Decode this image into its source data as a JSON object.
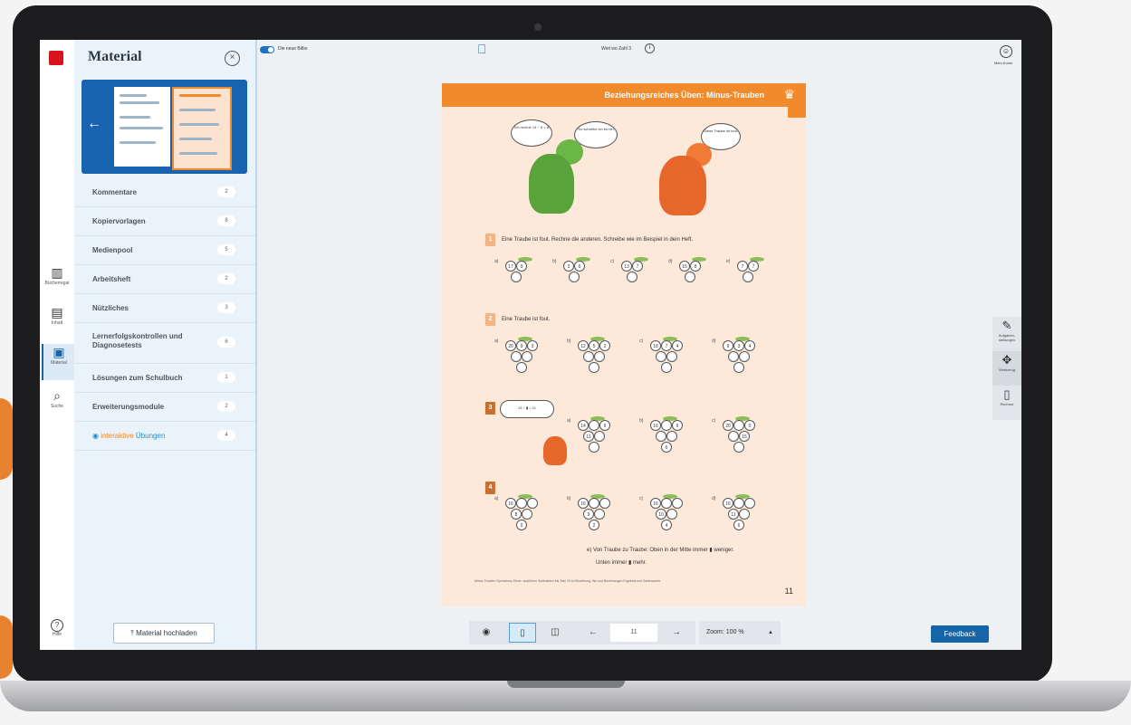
{
  "sidebar_rail": {
    "items": [
      {
        "label": "Bücherregal",
        "icon": "bookshelf-icon"
      },
      {
        "label": "Inhalt",
        "icon": "book-icon"
      },
      {
        "label": "Material",
        "icon": "material-icon"
      },
      {
        "label": "Suche",
        "icon": "search-icon"
      }
    ],
    "help_label": "Hilfe"
  },
  "panel": {
    "title": "Material",
    "items": [
      {
        "label": "Kommentare",
        "count": "2"
      },
      {
        "label": "Kopiervorlagen",
        "count": "8"
      },
      {
        "label": "Medienpool",
        "count": "5"
      },
      {
        "label": "Arbeitsheft",
        "count": "2"
      },
      {
        "label": "Nützliches",
        "count": "3"
      },
      {
        "label": "Lernerfolgskontrollen und Diagnosetests",
        "count": "6"
      },
      {
        "label": "Lösungen zum Schulbuch",
        "count": "1"
      },
      {
        "label": "Erweiterungsmodule",
        "count": "2"
      },
      {
        "label_a": "interaktive",
        "label_b": "Übungen",
        "count": "4"
      }
    ],
    "upload_label": "Material hochladen"
  },
  "header": {
    "toggle_label": "Die neue Bilbo",
    "breadcrumb": "Weit wo Zahl 3",
    "account_label": "Mein Konto"
  },
  "right_tools": [
    {
      "label": "Aufgaben-stellungen",
      "icon": "edit-icon"
    },
    {
      "label": "Werkzeug",
      "icon": "tools-icon"
    },
    {
      "label": "Rechner",
      "icon": "calculator-icon"
    }
  ],
  "page": {
    "title": "Beziehungsreiches Üben: Minus-Trauben",
    "task1": "Eine Traube ist fout. Rechne die anderen. Schreibe wie im Beispiel in dein Heft.",
    "task2": "Eine Traube ist fout.",
    "bottom_line": "e) Von Traube zu Traube: Oben in der Mitte immer ▮ weniger.",
    "bottom_line2": "Unten immer ▮ mehr.",
    "footnote": "Minus-Trauben Operations-Sinne: ausführen Subtraktion bis Zahl 20 im Beziehung. Wo und Beziehungen Ergebnis und Zahlenwerte.",
    "page_number": "11",
    "bubbles": [
      "Ich rechne 14 − 6 = 8",
      "So schreibe ich es hin",
      "Diese Traube ist fout."
    ],
    "hint_bubble": "13 − ▮ = 11",
    "grapes_row1": [
      {
        "label": "a)",
        "a": "17",
        "b": "9"
      },
      {
        "label": "b)",
        "a": "3",
        "b": "6"
      },
      {
        "label": "c)",
        "a": "13",
        "b": "7"
      },
      {
        "label": "d)",
        "a": "15",
        "b": "8"
      },
      {
        "label": "e)",
        "a": "7",
        "b": "7"
      }
    ],
    "grapes_row2": [
      {
        "label": "a)",
        "a": "20",
        "b": "9",
        "c": "3"
      },
      {
        "label": "b)",
        "a": "12",
        "b": "5",
        "c": "2"
      },
      {
        "label": "c)",
        "a": "18",
        "b": "7",
        "c": "4"
      },
      {
        "label": "d)",
        "a": "9",
        "b": "3",
        "c": "4"
      }
    ],
    "grapes_row3": [
      {
        "label": "a)",
        "a": "14",
        "b": "6",
        "c": "11"
      },
      {
        "label": "b)",
        "a": "16",
        "b": "6",
        "c": "6"
      },
      {
        "label": "c)",
        "a": "20",
        "b": "0",
        "c": "15"
      }
    ],
    "grapes_row4": [
      {
        "label": "a)",
        "a": "16",
        "b": "8",
        "c": "0"
      },
      {
        "label": "b)",
        "a": "16",
        "b": "9",
        "c": "2"
      },
      {
        "label": "c)",
        "a": "16",
        "b": "10",
        "c": "4"
      },
      {
        "label": "d)",
        "a": "16",
        "b": "11",
        "c": "6"
      }
    ]
  },
  "viewer": {
    "page_value": "11",
    "zoom_label": "Zoom: 100 %"
  },
  "feedback_label": "Feedback"
}
